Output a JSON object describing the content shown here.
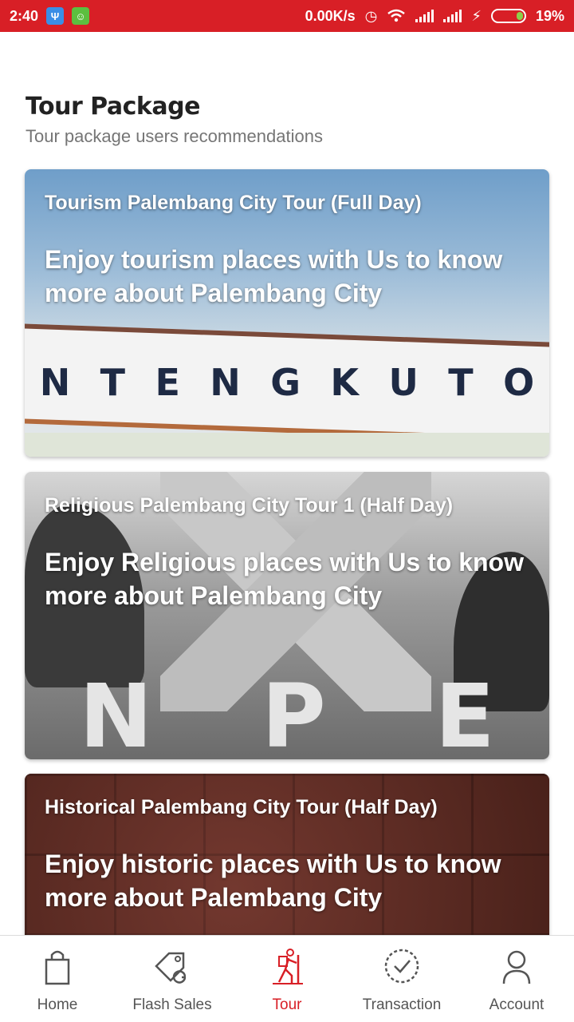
{
  "status_bar": {
    "time": "2:40",
    "network_speed": "0.00K/s",
    "battery_percent": "19%",
    "icons": [
      "usb-icon",
      "android-icon",
      "alarm-icon",
      "wifi-icon",
      "signal-icon",
      "signal-icon",
      "charging-icon",
      "battery-icon"
    ],
    "color": "#d81f26"
  },
  "header": {
    "title": "Tour Package",
    "subtitle": "Tour package users recommendations"
  },
  "cards": [
    {
      "title": "Tourism Palembang City Tour (Full Day)",
      "description": "Enjoy tourism places with Us to know more about Palembang City",
      "wall_letters": [
        "N",
        "T",
        "E",
        "N",
        "G",
        "K",
        "U",
        "T",
        "O"
      ]
    },
    {
      "title": "Religious Palembang City Tour 1 (Half Day)",
      "description": "Enjoy Religious places with Us to know more about Palembang City",
      "big_letters": [
        "N",
        "P",
        "E"
      ]
    },
    {
      "title": "Historical Palembang City Tour (Half Day)",
      "description": "Enjoy historic places with Us to know more about Palembang City"
    }
  ],
  "bottom_nav": {
    "items": [
      {
        "label": "Home",
        "icon": "shopping-bag-icon"
      },
      {
        "label": "Flash Sales",
        "icon": "tag-icon"
      },
      {
        "label": "Tour",
        "icon": "hiker-icon",
        "active": true
      },
      {
        "label": "Transaction",
        "icon": "check-circle-icon"
      },
      {
        "label": "Account",
        "icon": "user-icon"
      }
    ],
    "active_color": "#d81f26"
  }
}
